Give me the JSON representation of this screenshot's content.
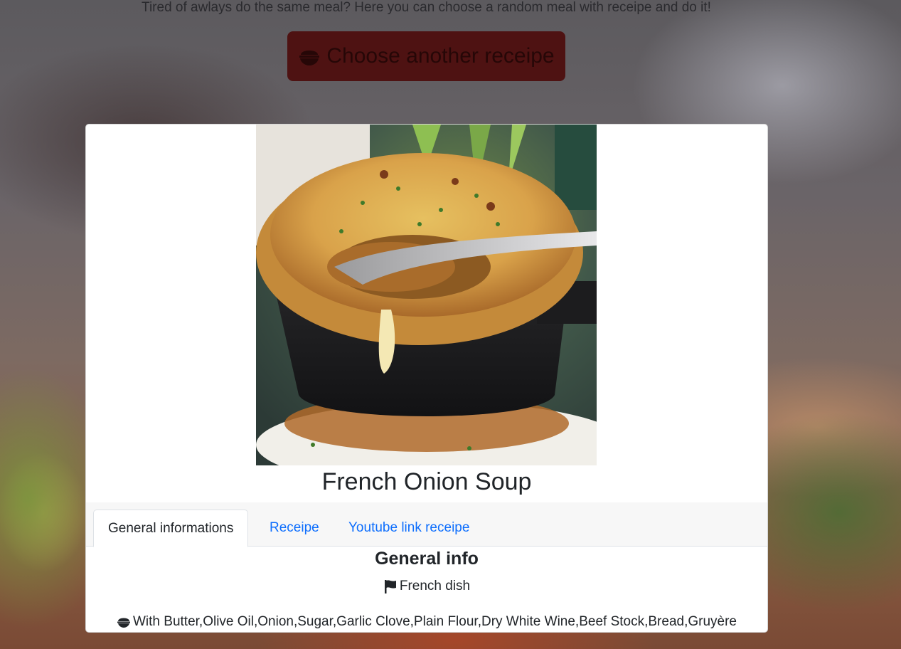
{
  "header": {
    "tagline": "Tired of awlays do the same meal? Here you can choose a random meal with receipe and do it!",
    "choose_button_label": "Choose another receipe"
  },
  "meal": {
    "title": "French Onion Soup",
    "image_icon": "meal-photo"
  },
  "tabs": [
    {
      "label": "General informations",
      "active": true
    },
    {
      "label": "Receipe",
      "active": false
    },
    {
      "label": "Youtube link receipe",
      "active": false
    }
  ],
  "general_info": {
    "heading": "General info",
    "origin": "French dish",
    "origin_icon": "flag-icon",
    "ingredients": "With Butter,Olive Oil,Onion,Sugar,Garlic Clove,Plain Flour,Dry White Wine,Beef Stock,Bread,Gruyère",
    "ingredients_icon": "bowl-icon"
  },
  "colors": {
    "button_bg": "#4e1212",
    "link": "#0d6efd",
    "text": "#212529"
  }
}
